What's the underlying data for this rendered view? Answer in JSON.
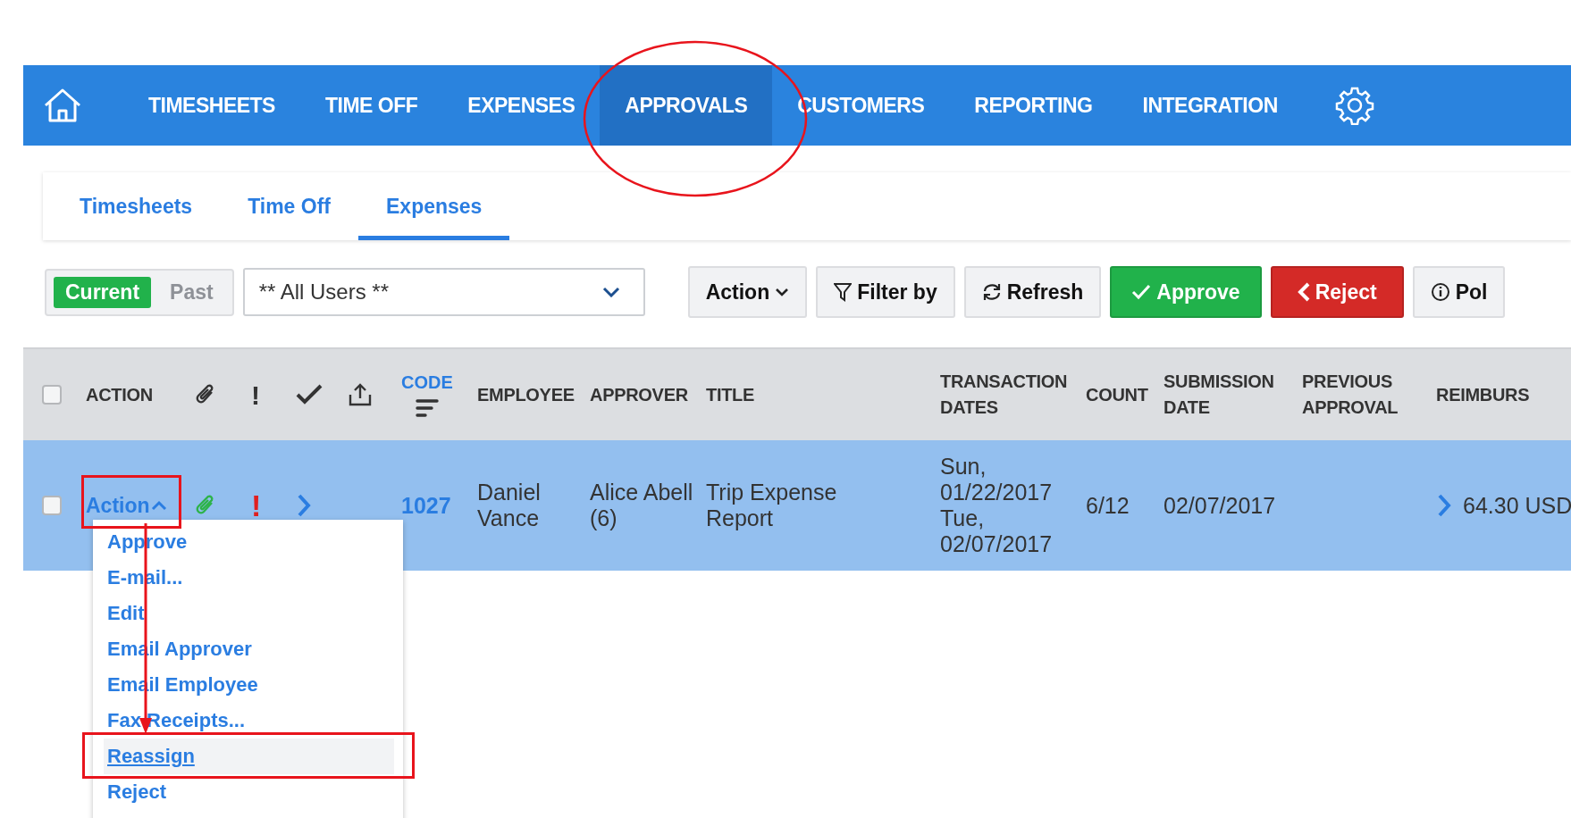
{
  "nav": {
    "items": [
      {
        "label": "TIMESHEETS",
        "selected": false
      },
      {
        "label": "TIME OFF",
        "selected": false
      },
      {
        "label": "EXPENSES",
        "selected": false
      },
      {
        "label": "APPROVALS",
        "selected": true
      },
      {
        "label": "CUSTOMERS",
        "selected": false
      },
      {
        "label": "REPORTING",
        "selected": false
      },
      {
        "label": "INTEGRATION",
        "selected": false
      }
    ]
  },
  "subtabs": [
    {
      "label": "Timesheets",
      "selected": false
    },
    {
      "label": "Time Off",
      "selected": false
    },
    {
      "label": "Expenses",
      "selected": true
    }
  ],
  "period": [
    {
      "label": "Current",
      "selected": true
    },
    {
      "label": "Past",
      "selected": false
    }
  ],
  "user_filter": {
    "value": "** All Users **"
  },
  "toolbar": [
    {
      "kind": "dropdown",
      "label": "Action"
    },
    {
      "kind": "filter",
      "label": "Filter by"
    },
    {
      "kind": "refresh",
      "label": "Refresh"
    },
    {
      "kind": "approve",
      "label": "Approve"
    },
    {
      "kind": "reject",
      "label": "Reject"
    },
    {
      "kind": "info",
      "label": "Pol"
    }
  ],
  "table": {
    "select_all_checked": false,
    "columns": [
      {
        "kind": "checkbox"
      },
      {
        "kind": "text",
        "label": "ACTION"
      },
      {
        "kind": "clip"
      },
      {
        "kind": "text",
        "label": "!"
      },
      {
        "kind": "check"
      },
      {
        "kind": "upload"
      },
      {
        "kind": "sort",
        "label": "CODE"
      },
      {
        "kind": "text",
        "label": "EMPLOYEE"
      },
      {
        "kind": "text",
        "label": "APPROVER"
      },
      {
        "kind": "text",
        "label": "TITLE"
      },
      {
        "kind": "text",
        "label": "TRANSACTION DATES"
      },
      {
        "kind": "text",
        "label": "COUNT"
      },
      {
        "kind": "text",
        "label": "SUBMISSION DATE"
      },
      {
        "kind": "text",
        "label": "PREVIOUS APPROVAL"
      },
      {
        "kind": "text",
        "label": "REIMBURS"
      }
    ],
    "rows": [
      {
        "selected": true,
        "checked": false,
        "action": "Action",
        "flag": "!",
        "code": "1027",
        "employee": "Daniel Vance",
        "approver": "Alice Abell (6)",
        "title": "Trip Expense Report",
        "transaction_dates": [
          "Sun, 01/22/2017",
          "Tue, 02/07/2017"
        ],
        "count": "6/12",
        "submission_date": "02/07/2017",
        "reimbursement": "64.30 USD"
      }
    ]
  },
  "action_menu": {
    "open": true,
    "items": [
      {
        "label": "Approve",
        "selected": false
      },
      {
        "label": "E-mail...",
        "selected": false
      },
      {
        "label": "Edit",
        "selected": false
      },
      {
        "label": "Email Approver",
        "selected": false
      },
      {
        "label": "Email Employee",
        "selected": false
      },
      {
        "label": "Fax Receipts...",
        "selected": false
      },
      {
        "label": "Reassign",
        "selected": true
      },
      {
        "label": "Reject",
        "selected": false
      }
    ]
  }
}
